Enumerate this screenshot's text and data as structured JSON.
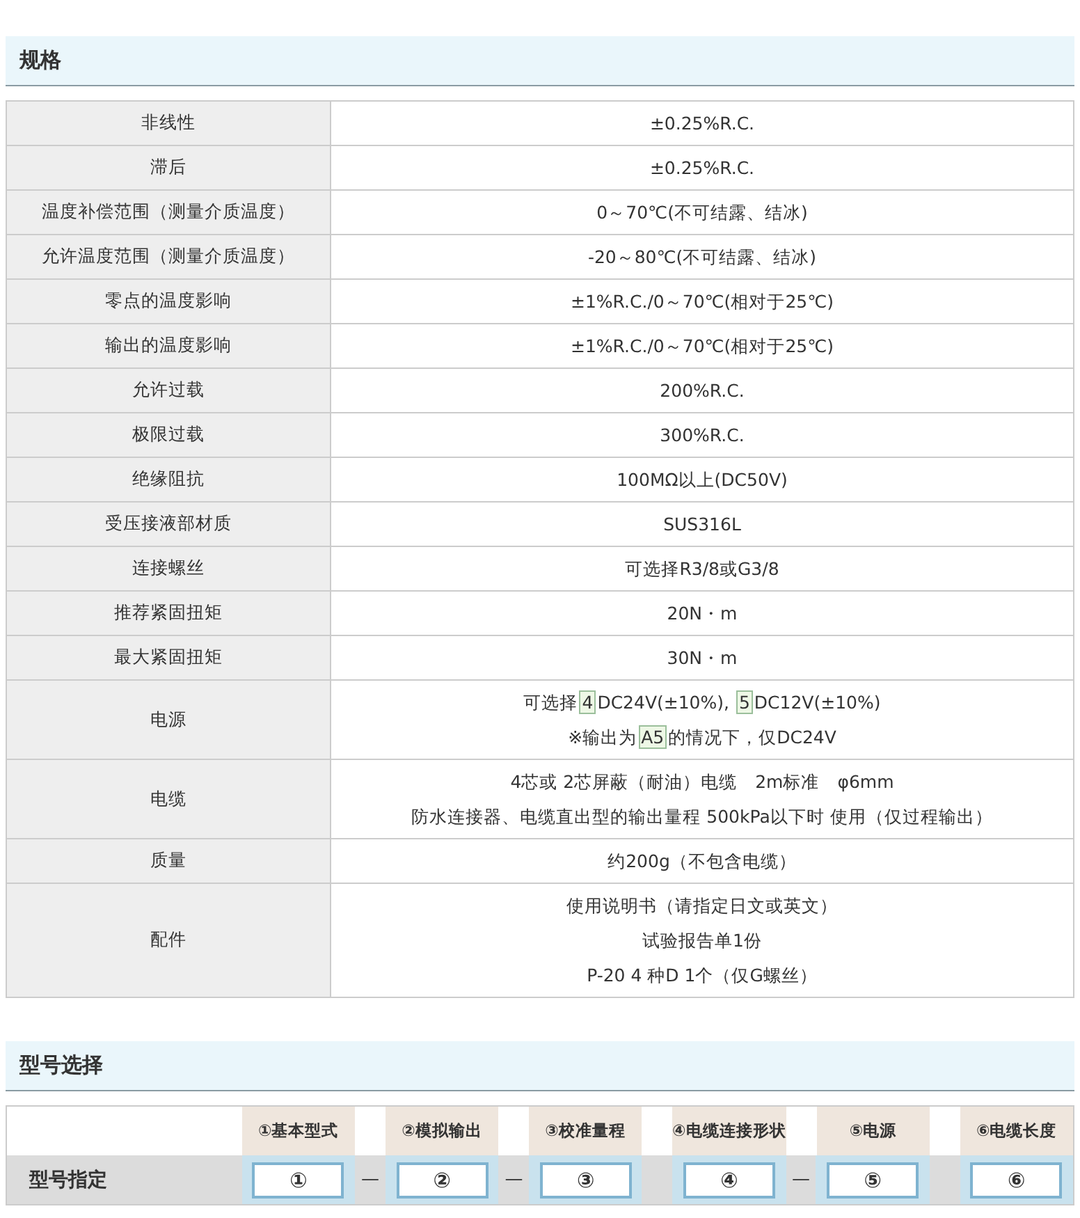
{
  "spec_section": {
    "title": "规格"
  },
  "spec_rows": [
    {
      "label": "非线性",
      "lines": [
        "±0.25%R.C."
      ]
    },
    {
      "label": "滞后",
      "lines": [
        "±0.25%R.C."
      ]
    },
    {
      "label": "温度补偿范围（测量介质温度）",
      "lines": [
        "0～70℃(不可结露、结冰)"
      ]
    },
    {
      "label": "允许温度范围（测量介质温度）",
      "lines": [
        "-20～80℃(不可结露、结冰)"
      ]
    },
    {
      "label": "零点的温度影响",
      "lines": [
        "±1%R.C./0～70℃(相对于25℃)"
      ]
    },
    {
      "label": "输出的温度影响",
      "lines": [
        "±1%R.C./0～70℃(相对于25℃)"
      ]
    },
    {
      "label": "允许过载",
      "lines": [
        "200%R.C."
      ]
    },
    {
      "label": "极限过载",
      "lines": [
        "300%R.C."
      ]
    },
    {
      "label": "绝缘阻抗",
      "lines": [
        "100MΩ以上(DC50V)"
      ]
    },
    {
      "label": "受压接液部材质",
      "lines": [
        "SUS316L"
      ]
    },
    {
      "label": "连接螺丝",
      "lines": [
        "可选择R3/8或G3/8"
      ]
    },
    {
      "label": "推荐紧固扭矩",
      "lines": [
        "20N・m"
      ]
    },
    {
      "label": "最大紧固扭矩",
      "lines": [
        "30N・m"
      ]
    },
    {
      "label": "电源",
      "lines": [
        {
          "parts": [
            {
              "kind": "text",
              "text": "可选择"
            },
            {
              "kind": "code",
              "text": "4"
            },
            {
              "kind": "text",
              "text": "DC24V(±10%), "
            },
            {
              "kind": "code",
              "text": "5"
            },
            {
              "kind": "text",
              "text": "DC12V(±10%)"
            }
          ]
        },
        {
          "parts": [
            {
              "kind": "text",
              "text": "※输出为"
            },
            {
              "kind": "code",
              "text": "A5"
            },
            {
              "kind": "text",
              "text": "的情况下，仅DC24V"
            }
          ]
        }
      ]
    },
    {
      "label": "电缆",
      "lines": [
        "4芯或 2芯屏蔽（耐油）电缆　2m标准　φ6mm",
        "防水连接器、电缆直出型的输出量程 500kPa以下时 使用（仅过程输出）"
      ]
    },
    {
      "label": "质量",
      "lines": [
        "约200g（不包含电缆）"
      ]
    },
    {
      "label": "配件",
      "lines": [
        "使用说明书（请指定日文或英文）",
        "试验报告单1份",
        "P-20  4 种D 1个（仅G螺丝）"
      ]
    }
  ],
  "model_section": {
    "title": "型号选择"
  },
  "model_table": {
    "row_label": "型号指定",
    "columns": [
      {
        "header": "①基本型式",
        "field": "①",
        "dash_after": "—"
      },
      {
        "header": "②模拟输出",
        "field": "②",
        "dash_after": "—"
      },
      {
        "header": "③校准量程",
        "field": "③"
      },
      {
        "header": "④电缆连接形状",
        "field": "④",
        "dash_after": "—"
      },
      {
        "header": "⑤电源",
        "field": "⑤"
      },
      {
        "header": "⑥电缆长度",
        "field": "⑥"
      }
    ]
  }
}
